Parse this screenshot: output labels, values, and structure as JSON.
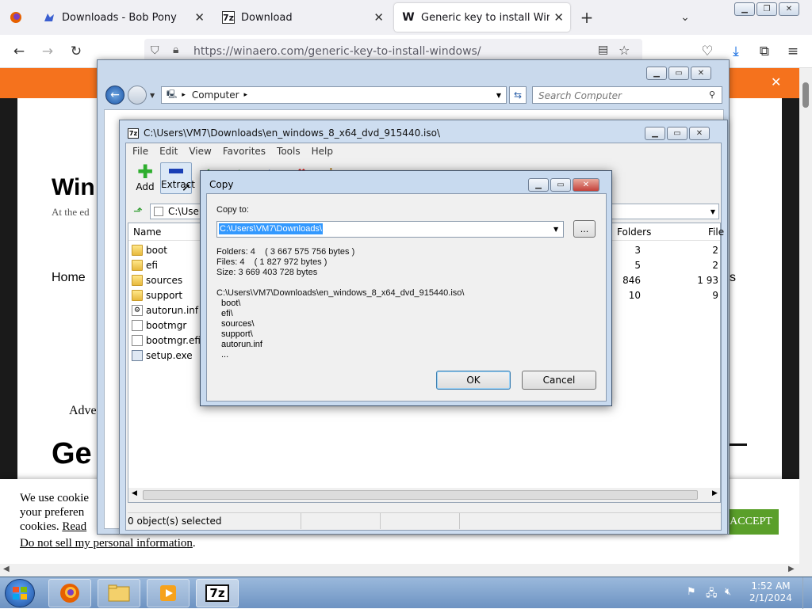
{
  "browser": {
    "tabs": [
      {
        "title": "Downloads - Bob Pony",
        "favicon": "bob-pony-favicon"
      },
      {
        "title": "Download",
        "favicon": "7z-favicon",
        "favicon_text": "7z"
      },
      {
        "title": "Generic key to install Windows",
        "favicon": "winaero-favicon",
        "favicon_text": "W"
      }
    ],
    "url": "https://winaero.com/generic-key-to-install-windows/"
  },
  "webpage": {
    "site_title_fragment": "Win",
    "tagline_fragment": "At the ed",
    "nav_home": "Home",
    "nav_right_fragment": "s",
    "adv_fragment": "Adve",
    "heading_fragment": "Ge",
    "cookie": {
      "line1": "We use cookie",
      "line2": "your preferen",
      "line3_prefix": "cookies. ",
      "read_link": "Read",
      "do_not_sell": "Do not sell my personal information",
      "do_not_sell_suffix": ".",
      "accept_label": "ACCEPT"
    }
  },
  "explorer": {
    "address": "Computer",
    "search_placeholder": "Search Computer"
  },
  "sevenzip": {
    "title": "C:\\Users\\VM7\\Downloads\\en_windows_8_x64_dvd_915440.iso\\",
    "title_icon": "7z",
    "menu": [
      "File",
      "Edit",
      "View",
      "Favorites",
      "Tools",
      "Help"
    ],
    "toolbar": {
      "add": "Add",
      "extract": "Extract"
    },
    "path_fragment": "C:\\User",
    "columns": {
      "name": "Name",
      "folders": "Folders",
      "files": "File"
    },
    "files": [
      {
        "name": "boot",
        "type": "folder",
        "folders": "3",
        "files": "2"
      },
      {
        "name": "efi",
        "type": "folder",
        "folders": "5",
        "files": "2"
      },
      {
        "name": "sources",
        "type": "folder",
        "folders": "846",
        "files": "1 93"
      },
      {
        "name": "support",
        "type": "folder",
        "folders": "10",
        "files": "9"
      },
      {
        "name": "autorun.inf",
        "type": "inf",
        "folders": "",
        "files": ""
      },
      {
        "name": "bootmgr",
        "type": "file",
        "folders": "",
        "files": ""
      },
      {
        "name": "bootmgr.efi",
        "type": "file",
        "folders": "",
        "files": ""
      },
      {
        "name": "setup.exe",
        "type": "exe",
        "folders": "",
        "files": ""
      }
    ],
    "status": "0 object(s) selected"
  },
  "copy_dialog": {
    "title": "Copy",
    "copy_to_label": "Copy to:",
    "destination": "C:\\Users\\VM7\\Downloads\\",
    "browse_label": "...",
    "folders_line": "Folders: 4    ( 3 667 575 756 bytes )",
    "files_line": "Files: 4    ( 1 827 972 bytes )",
    "size_line": "Size: 3 669 403 728 bytes",
    "source_path": "C:\\Users\\VM7\\Downloads\\en_windows_8_x64_dvd_915440.iso\\",
    "items": [
      "boot\\",
      "efi\\",
      "sources\\",
      "support\\",
      "autorun.inf",
      "..."
    ],
    "ok_label": "OK",
    "cancel_label": "Cancel"
  },
  "taskbar": {
    "time": "1:52 AM",
    "date": "2/1/2024",
    "sevenzip_label": "7z"
  }
}
